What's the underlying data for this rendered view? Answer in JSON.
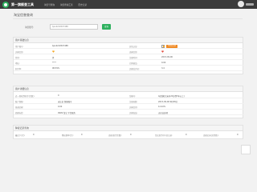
{
  "nav": {
    "brand": "第一旗舰查工具",
    "links": [
      "淘宝号查询",
      "淘宝查询工具",
      "历史记录"
    ]
  },
  "page_title": "淘宝信誉查询",
  "search": {
    "label": "淘宝账号:",
    "value": "tjan4210507488",
    "button": "查询"
  },
  "basic_info": {
    "heading": "用户基础信息",
    "rows": [
      {
        "l1": "用户账号:",
        "v1": "tjan4210507488",
        "l2": "实名认证:",
        "v2": "",
        "badge": "已实名认证"
      },
      {
        "l1": "买家信誉:",
        "v1": "",
        "l2": "卖家信誉:",
        "v2": ""
      },
      {
        "l1": "性别:",
        "v1": "男",
        "l2": "注册时间:",
        "v2": "2015-09-06"
      },
      {
        "l1": "地址:",
        "v1": "****",
        "l2": "已购商品:",
        "v2": "0.00"
      },
      {
        "l1": "好评率:",
        "v1": "98.59%",
        "l2": "买家总评价:",
        "v2": "3.4"
      }
    ]
  },
  "detail_info": {
    "heading": "用户详细信息",
    "rows": [
      {
        "l1": "近一周收到好评(次数):",
        "v1": "0",
        "l2": "淘客号:",
        "v2": "年龄满足(未有20岁到5年以上)"
      },
      {
        "l1": "账户保障:",
        "v1": "未认证 保障账号",
        "l2": "注册天数:",
        "v2": "2015-09-06 9时08分"
      },
      {
        "l1": "普通买家:",
        "v1": "0.00",
        "l2": "买家信用:",
        "v2": "12.02%"
      },
      {
        "l1": "商家标签:",
        "v1": "9999 淘宝 平台服务",
        "l2": "买家权益:",
        "v2": "无价店选项"
      }
    ]
  },
  "history": {
    "heading": "降权记录查询",
    "labels": [
      "最近下(次):",
      "降权频率(次):",
      "违规(处罚次数):",
      "淘宝处罚(中)总记录:",
      "违规记录(处罚数):"
    ],
    "values": [
      "0",
      "0",
      "0",
      "0",
      "0"
    ]
  },
  "colors": {
    "navbar": "#3b3b3b",
    "accent": "#2fb15f",
    "badge": "#f08a24",
    "heart_orange": "#f5a623",
    "heart_red": "#e0483a"
  }
}
